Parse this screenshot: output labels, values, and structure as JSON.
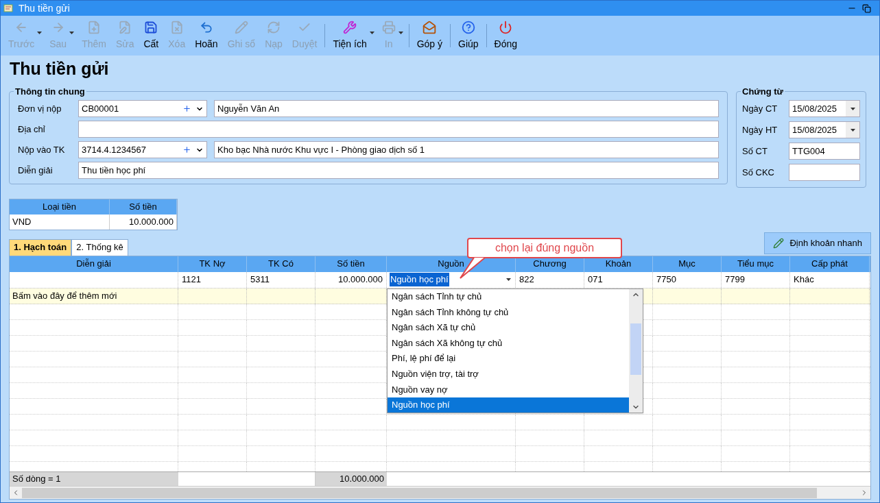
{
  "window": {
    "title": "Thu tiền gửi"
  },
  "toolbar": [
    {
      "label": "Trước",
      "disabled": true,
      "caret": true
    },
    {
      "label": "Sau",
      "disabled": true,
      "caret": true
    },
    {
      "label": "Thêm",
      "disabled": true,
      "caret": false
    },
    {
      "label": "Sửa",
      "disabled": true,
      "caret": false
    },
    {
      "label": "Cất",
      "disabled": false,
      "caret": false
    },
    {
      "label": "Xóa",
      "disabled": true,
      "caret": false
    },
    {
      "label": "Hoãn",
      "disabled": false,
      "caret": false
    },
    {
      "label": "Ghi sổ",
      "disabled": true,
      "caret": false
    },
    {
      "label": "Nạp",
      "disabled": true,
      "caret": false
    },
    {
      "label": "Duyệt",
      "disabled": true,
      "caret": false
    },
    {
      "label": "Tiện ích",
      "disabled": false,
      "caret": true
    },
    {
      "label": "In",
      "disabled": true,
      "caret": true
    },
    {
      "label": "Góp ý",
      "disabled": false,
      "caret": false
    },
    {
      "label": "Giúp",
      "disabled": false,
      "caret": false
    },
    {
      "label": "Đóng",
      "disabled": false,
      "caret": false
    }
  ],
  "form_title": "Thu tiền gửi",
  "general": {
    "legend": "Thông tin chung",
    "fields": [
      {
        "kind": "lookup",
        "label": "Đơn vị nộp",
        "code": "CB00001",
        "name": "Nguyễn Văn An"
      },
      {
        "kind": "text",
        "label": "Địa chỉ"
      },
      {
        "kind": "lookup",
        "label": "Nộp vào TK",
        "code": "3714.4.1234567",
        "name": "Kho bạc Nhà nước Khu vực I - Phòng giao dịch số 1"
      },
      {
        "kind": "text",
        "label": "Diễn giải",
        "value": "Thu tiền học phí"
      }
    ]
  },
  "voucher": {
    "legend": "Chứng từ",
    "fields": [
      {
        "kind": "date",
        "label": "Ngày CT",
        "value": "15/08/2025"
      },
      {
        "kind": "date",
        "label": "Ngày HT",
        "value": "15/08/2025"
      },
      {
        "kind": "text",
        "label": "Số CT",
        "value": "TTG004"
      },
      {
        "kind": "text",
        "label": "Số CKC"
      }
    ]
  },
  "currency": {
    "columns": [
      "Loại tiền",
      "Số tiền"
    ],
    "rows": [
      [
        "VND",
        "10.000.000"
      ]
    ]
  },
  "tabs": [
    {
      "label": "1. Hạch toán",
      "selected": true
    },
    {
      "label": "2. Thống kê",
      "selected": false
    }
  ],
  "quick_button": "Định khoản nhanh",
  "grid": {
    "columns": [
      "Diễn giải",
      "TK Nợ",
      "TK Có",
      "Số tiền",
      "Nguồn",
      "Chương",
      "Khoản",
      "Mục",
      "Tiểu mục",
      "Cấp phát"
    ],
    "rows": [
      [
        "",
        "1121",
        "5311",
        "10.000.000",
        "Nguồn học phí",
        "822",
        "071",
        "7750",
        "7799",
        "Khác"
      ]
    ],
    "new_row_hint": "Bấm vào đây để thêm mới",
    "footer": {
      "count": "Số dòng = 1",
      "amount": "10.000.000"
    }
  },
  "dropdown": {
    "items": [
      {
        "label": "Ngân sách Tỉnh tự chủ",
        "selected": false
      },
      {
        "label": "Ngân sách Tỉnh không tự chủ",
        "selected": false
      },
      {
        "label": "Ngân sách Xã tự chủ",
        "selected": false
      },
      {
        "label": "Ngân sách Xã không tự chủ",
        "selected": false
      },
      {
        "label": "Phí, lệ phí để lại",
        "selected": false
      },
      {
        "label": "Nguồn viện trợ, tài trợ",
        "selected": false
      },
      {
        "label": "Nguồn vay nợ",
        "selected": false
      },
      {
        "label": "Nguồn học phí",
        "selected": true
      }
    ]
  },
  "callout": "chọn lại đúng nguồn"
}
